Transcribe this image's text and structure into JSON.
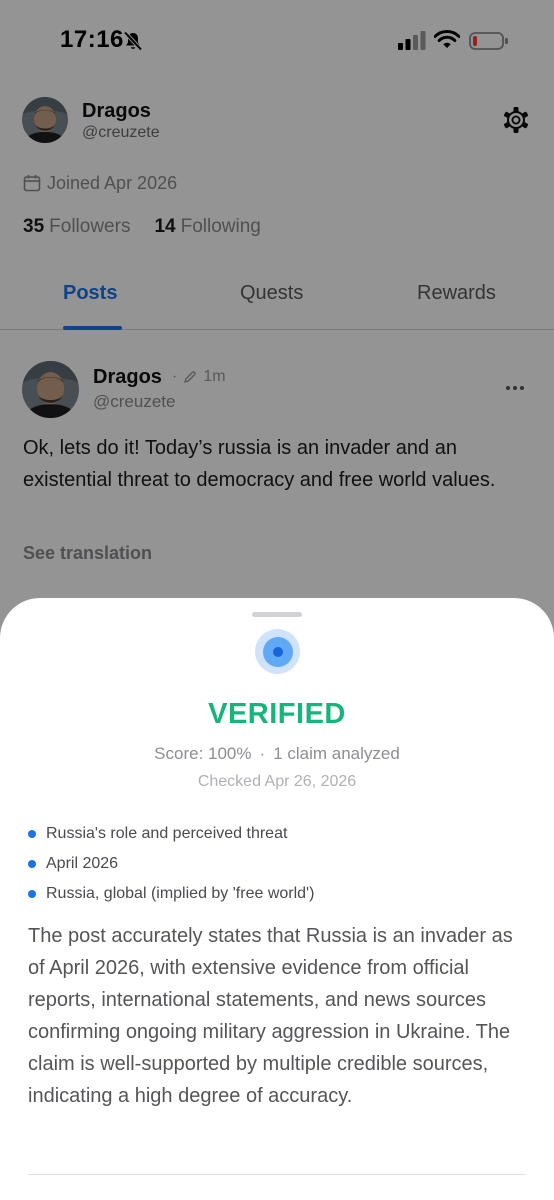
{
  "status_bar": {
    "time": "17:16"
  },
  "profile": {
    "name": "Dragos",
    "handle": "@creuzete",
    "joined": "Joined Apr 2026",
    "followers_count": "35",
    "followers_label": "Followers",
    "following_count": "14",
    "following_label": "Following"
  },
  "tabs": [
    {
      "label": "Posts",
      "active": true
    },
    {
      "label": "Quests",
      "active": false
    },
    {
      "label": "Rewards",
      "active": false
    }
  ],
  "post": {
    "author_name": "Dragos",
    "time_ago": "1m",
    "author_handle": "@creuzete",
    "text": "Ok, lets do it! Today’s russia is an invader and an existential threat to democracy and free world values.",
    "see_translation": "See translation"
  },
  "fact_check": {
    "verdict": "VERIFIED",
    "score": "Score: 100%",
    "claims_analyzed": "1 claim analyzed",
    "checked_date": "Checked Apr 26, 2026",
    "claims": [
      "Russia's role and perceived threat",
      "April 2026",
      "Russia, global (implied by 'free world')"
    ],
    "summary": "The post accurately states that Russia is an invader as of April 2026, with extensive evidence from official reports, international statements, and news sources confirming ongoing military aggression in Ukraine. The claim is well-supported by multiple credible sources, indicating a high degree of accuracy."
  },
  "colors": {
    "accent": "#1a73e8",
    "verified": "#17b57a"
  }
}
